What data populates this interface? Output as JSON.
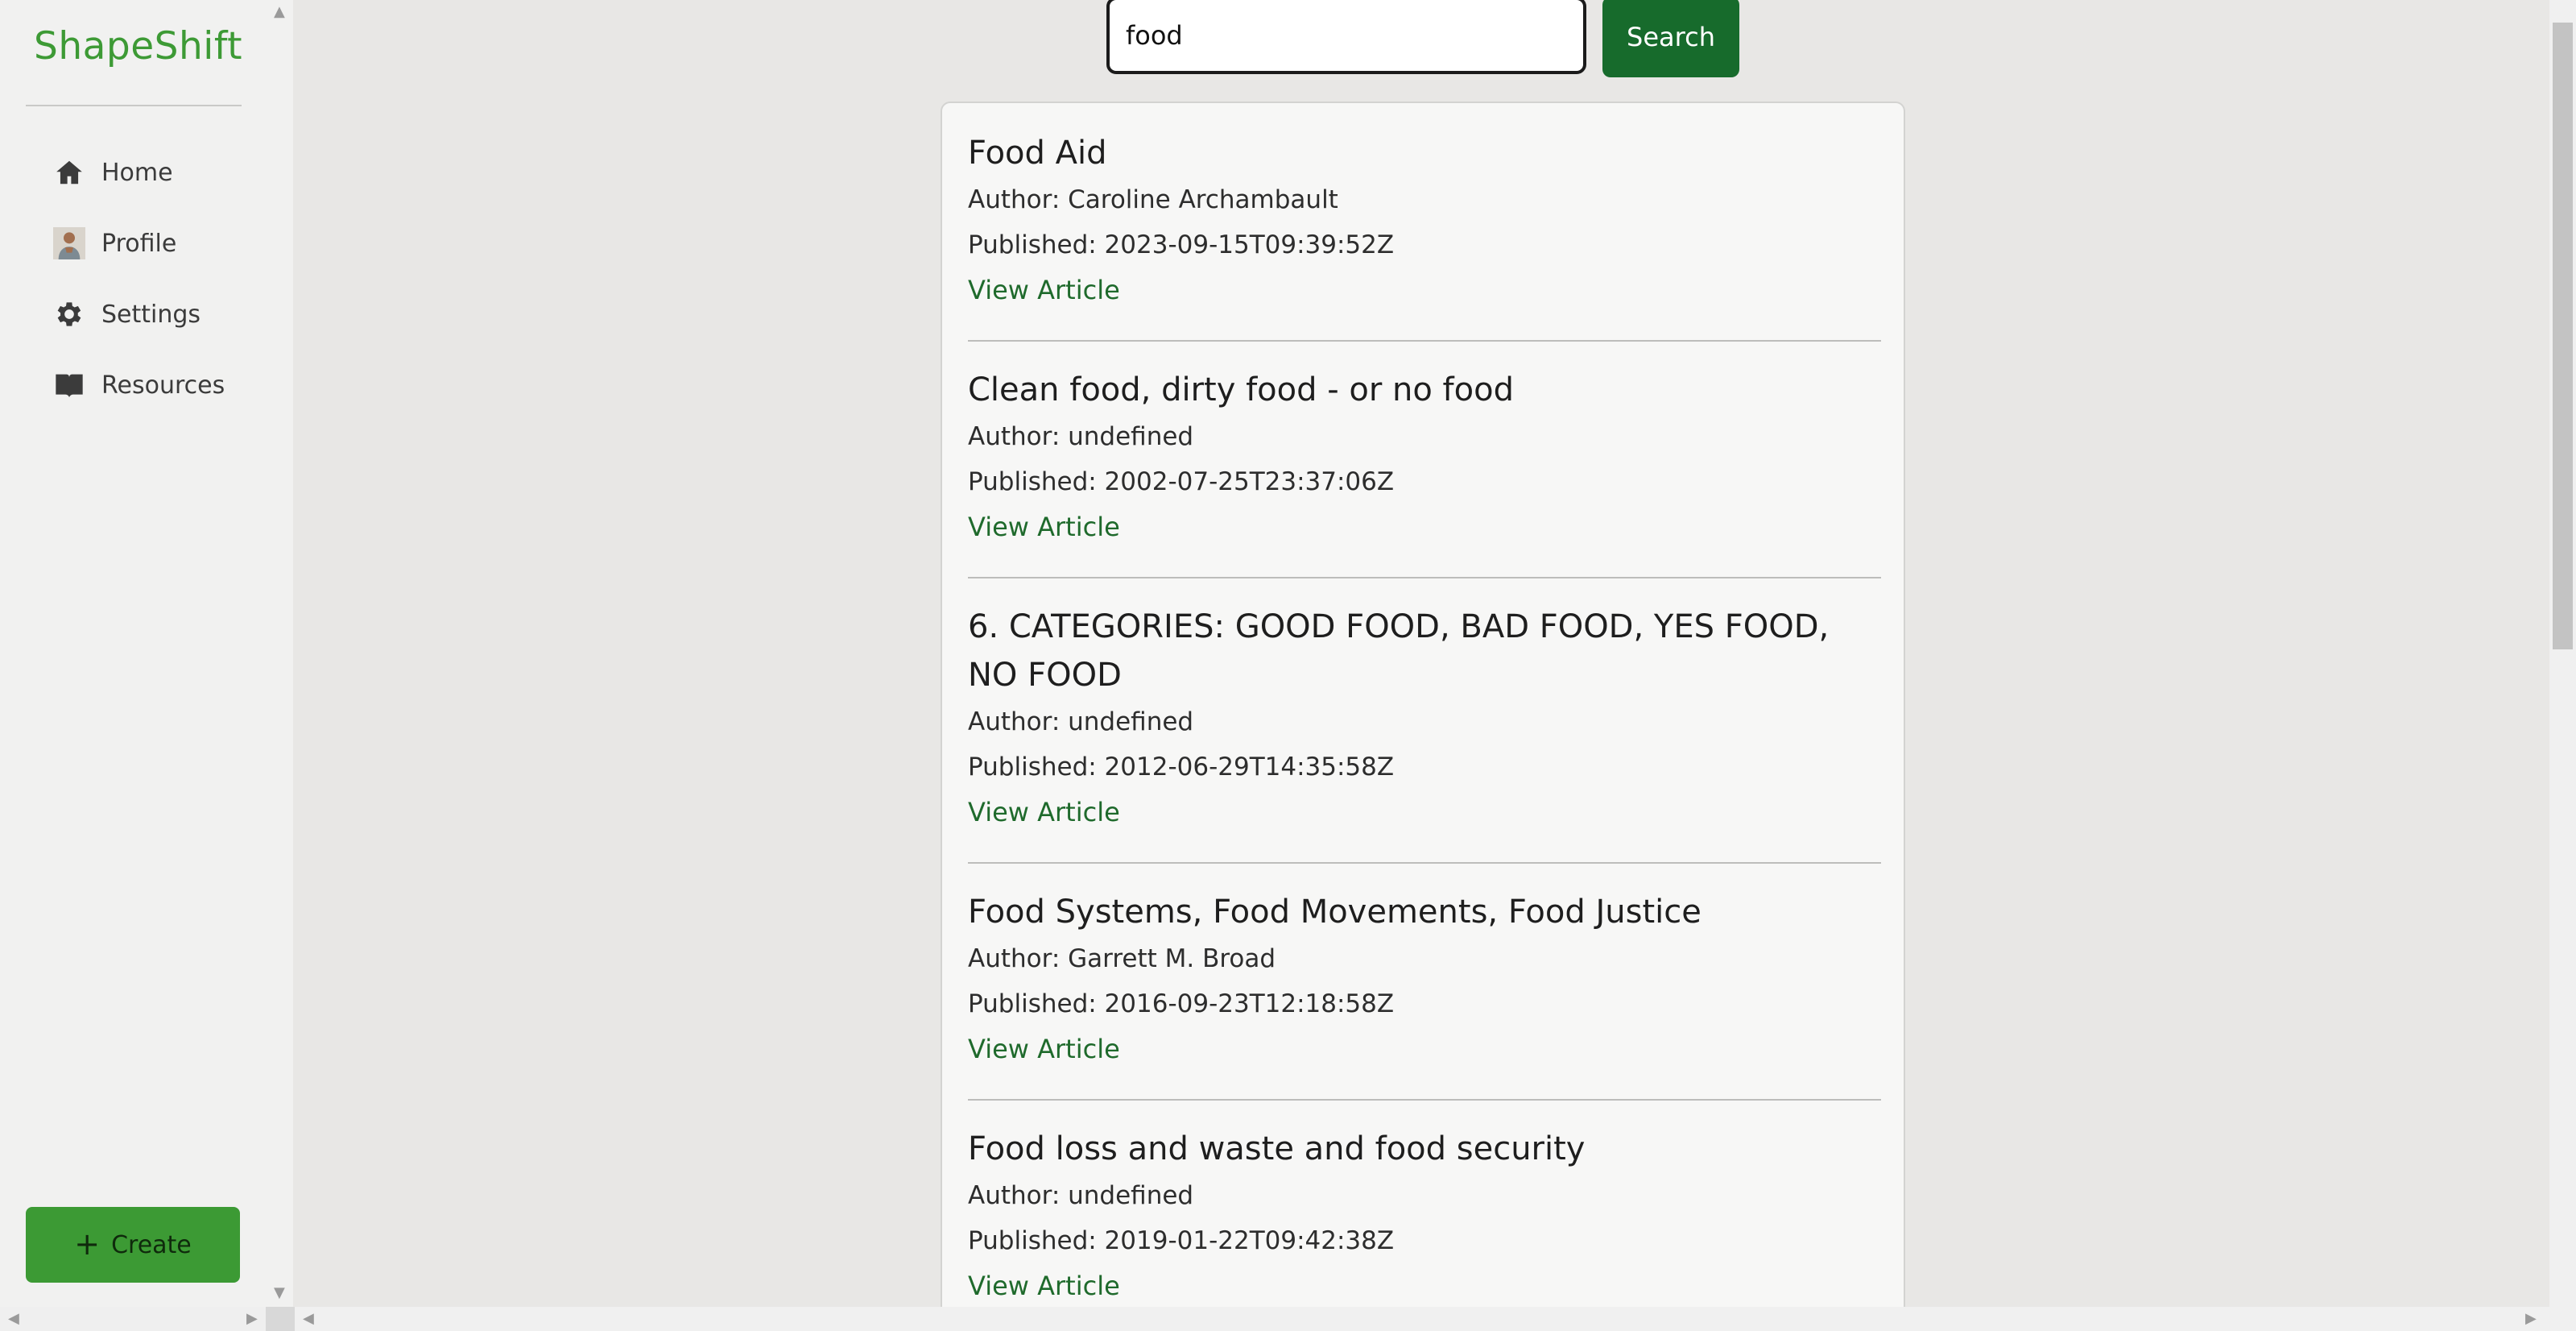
{
  "app": {
    "brand": "ShapeShift"
  },
  "sidebar": {
    "items": [
      {
        "label": "Home",
        "icon": "home-icon"
      },
      {
        "label": "Profile",
        "icon": "avatar"
      },
      {
        "label": "Settings",
        "icon": "gear-icon"
      },
      {
        "label": "Resources",
        "icon": "book-icon"
      }
    ],
    "create_label": "Create"
  },
  "search": {
    "value": "food",
    "button_label": "Search"
  },
  "results": [
    {
      "title": "Food Aid",
      "author": "Author: Caroline Archambault",
      "published": "Published: 2023-09-15T09:39:52Z",
      "link": "View Article"
    },
    {
      "title": "Clean food, dirty food - or no food",
      "author": "Author: undefined",
      "published": "Published: 2002-07-25T23:37:06Z",
      "link": "View Article"
    },
    {
      "title": "6. CATEGORIES: GOOD FOOD, BAD FOOD, YES FOOD, NO FOOD",
      "author": "Author: undefined",
      "published": "Published: 2012-06-29T14:35:58Z",
      "link": "View Article"
    },
    {
      "title": "Food Systems, Food Movements, Food Justice",
      "author": "Author: Garrett M. Broad",
      "published": "Published: 2016-09-23T12:18:58Z",
      "link": "View Article"
    },
    {
      "title": "Food loss and waste and food security",
      "author": "Author: undefined",
      "published": "Published: 2019-01-22T09:42:38Z",
      "link": "View Article"
    }
  ],
  "colors": {
    "brand": "#3d9a35",
    "primary_button": "#176b2c",
    "link": "#1f6a2c",
    "create_button": "#3c9a34"
  }
}
